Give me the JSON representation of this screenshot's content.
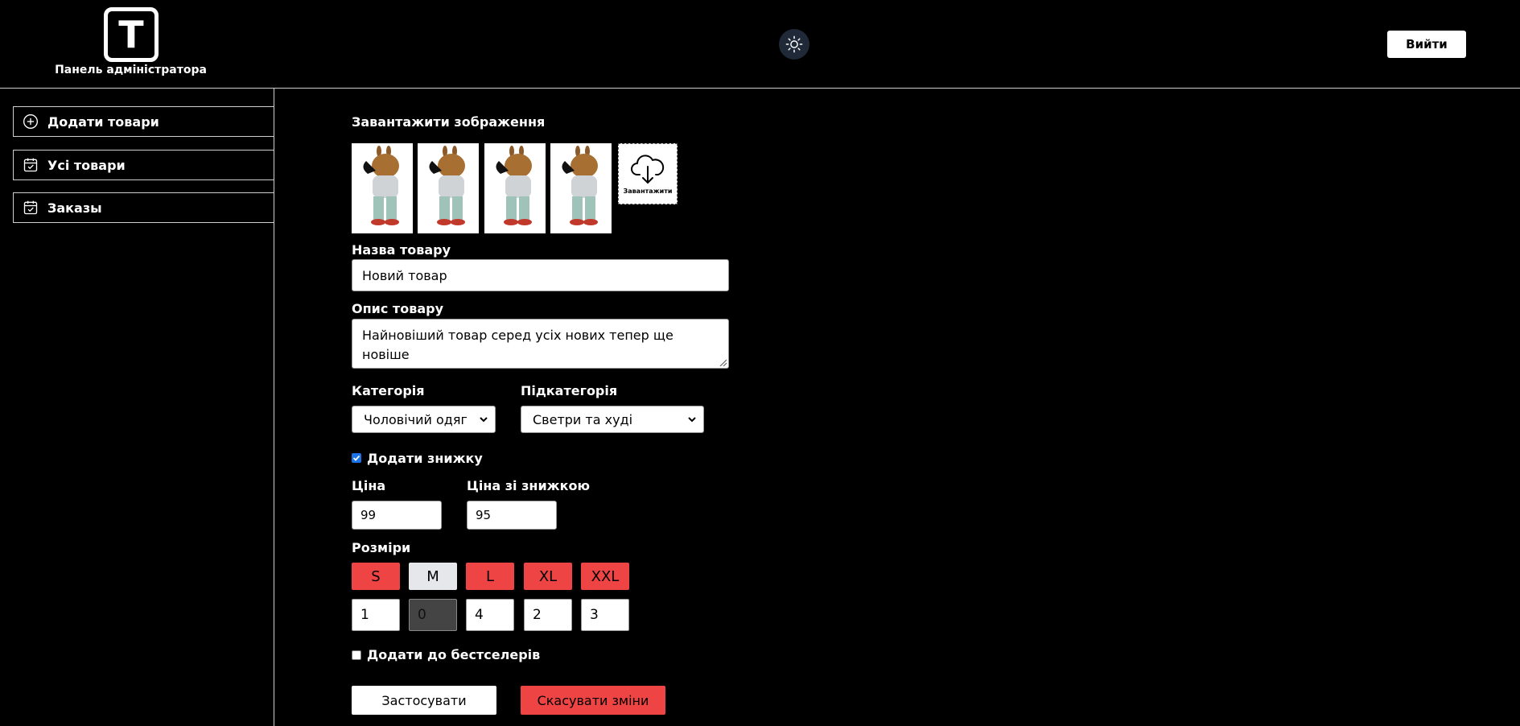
{
  "header": {
    "logo_letter": "T",
    "logo_caption": "Панель адміністратора",
    "theme_toggle_icon": "sun-icon",
    "logout_label": "Вийти"
  },
  "sidebar": {
    "items": [
      {
        "label": "Додати товари",
        "icon": "plus-circle-icon"
      },
      {
        "label": "Усі товари",
        "icon": "calendar-check-icon"
      },
      {
        "label": "Заказы",
        "icon": "calendar-check-icon"
      }
    ]
  },
  "form": {
    "upload_heading": "Завантажити зображення",
    "upload_button_label": "Завантажити",
    "thumbnail_count": 4,
    "name_label": "Назва товару",
    "name_value": "Новий товар",
    "description_label": "Опис товару",
    "description_value": "Найновіший товар серед усіх нових тепер ще новіше",
    "category_label": "Категорія",
    "category_value": "Чоловічий одяг",
    "subcategory_label": "Підкатегорія",
    "subcategory_value": "Светри та худі",
    "discount_checkbox_label": "Додати знижку",
    "discount_checked": true,
    "price_label": "Ціна",
    "price_value": "99",
    "discount_price_label": "Ціна зі знижкою",
    "discount_price_value": "95",
    "sizes_label": "Розміри",
    "sizes": [
      {
        "label": "S",
        "selected": true,
        "qty": "1"
      },
      {
        "label": "M",
        "selected": false,
        "qty": "0"
      },
      {
        "label": "L",
        "selected": true,
        "qty": "4"
      },
      {
        "label": "XL",
        "selected": true,
        "qty": "2"
      },
      {
        "label": "XXL",
        "selected": true,
        "qty": "3"
      }
    ],
    "bestseller_checkbox_label": "Додати до бестселерів",
    "bestseller_checked": false,
    "apply_label": "Застосувати",
    "cancel_label": "Скасувати зміни"
  },
  "colors": {
    "background": "#000000",
    "accent_red": "#ef4444",
    "unselected_size": "#e5e7eb",
    "toggle_bg": "#1f2937"
  }
}
